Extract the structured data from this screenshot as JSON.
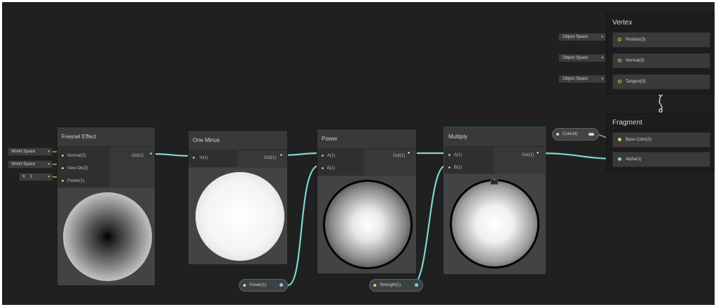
{
  "nodes": {
    "fresnel": {
      "title": "Fresnel Effect",
      "inputs": [
        "Normal(3)",
        "View Dir(3)",
        "Power(1)"
      ],
      "output": "Out(1)",
      "fields": {
        "normal_space": "World Space",
        "view_space": "World Space",
        "power_axis": "X",
        "power_value": "1"
      }
    },
    "one_minus": {
      "title": "One Minus",
      "input": "In(1)",
      "output": "Out(1)"
    },
    "power": {
      "title": "Power",
      "inputs": [
        "A(1)",
        "B(1)"
      ],
      "output": "Out(1)"
    },
    "multiply": {
      "title": "Multiply",
      "inputs": [
        "A(1)",
        "B(1)"
      ],
      "output": "Out(1)",
      "collapse_symbol": "^"
    }
  },
  "properties": {
    "power": "Power(1)",
    "strength": "Strength(1)",
    "color": "Color(4)"
  },
  "vertex": {
    "title": "Vertex",
    "space_label": "Object Space",
    "blocks": [
      "Position(3)",
      "Normal(3)",
      "Tangent(3)"
    ]
  },
  "fragment": {
    "title": "Fragment",
    "blocks": [
      "Base Color(3)",
      "Alpha(1)"
    ]
  },
  "colors": {
    "canvas": "#202020",
    "wire": "#7fd6d2",
    "port_yellow": "#d9d36a",
    "node_body": "#3c3c3c"
  },
  "icons": {
    "dropdown": "caret-down-icon",
    "port": "port-dot-icon"
  }
}
